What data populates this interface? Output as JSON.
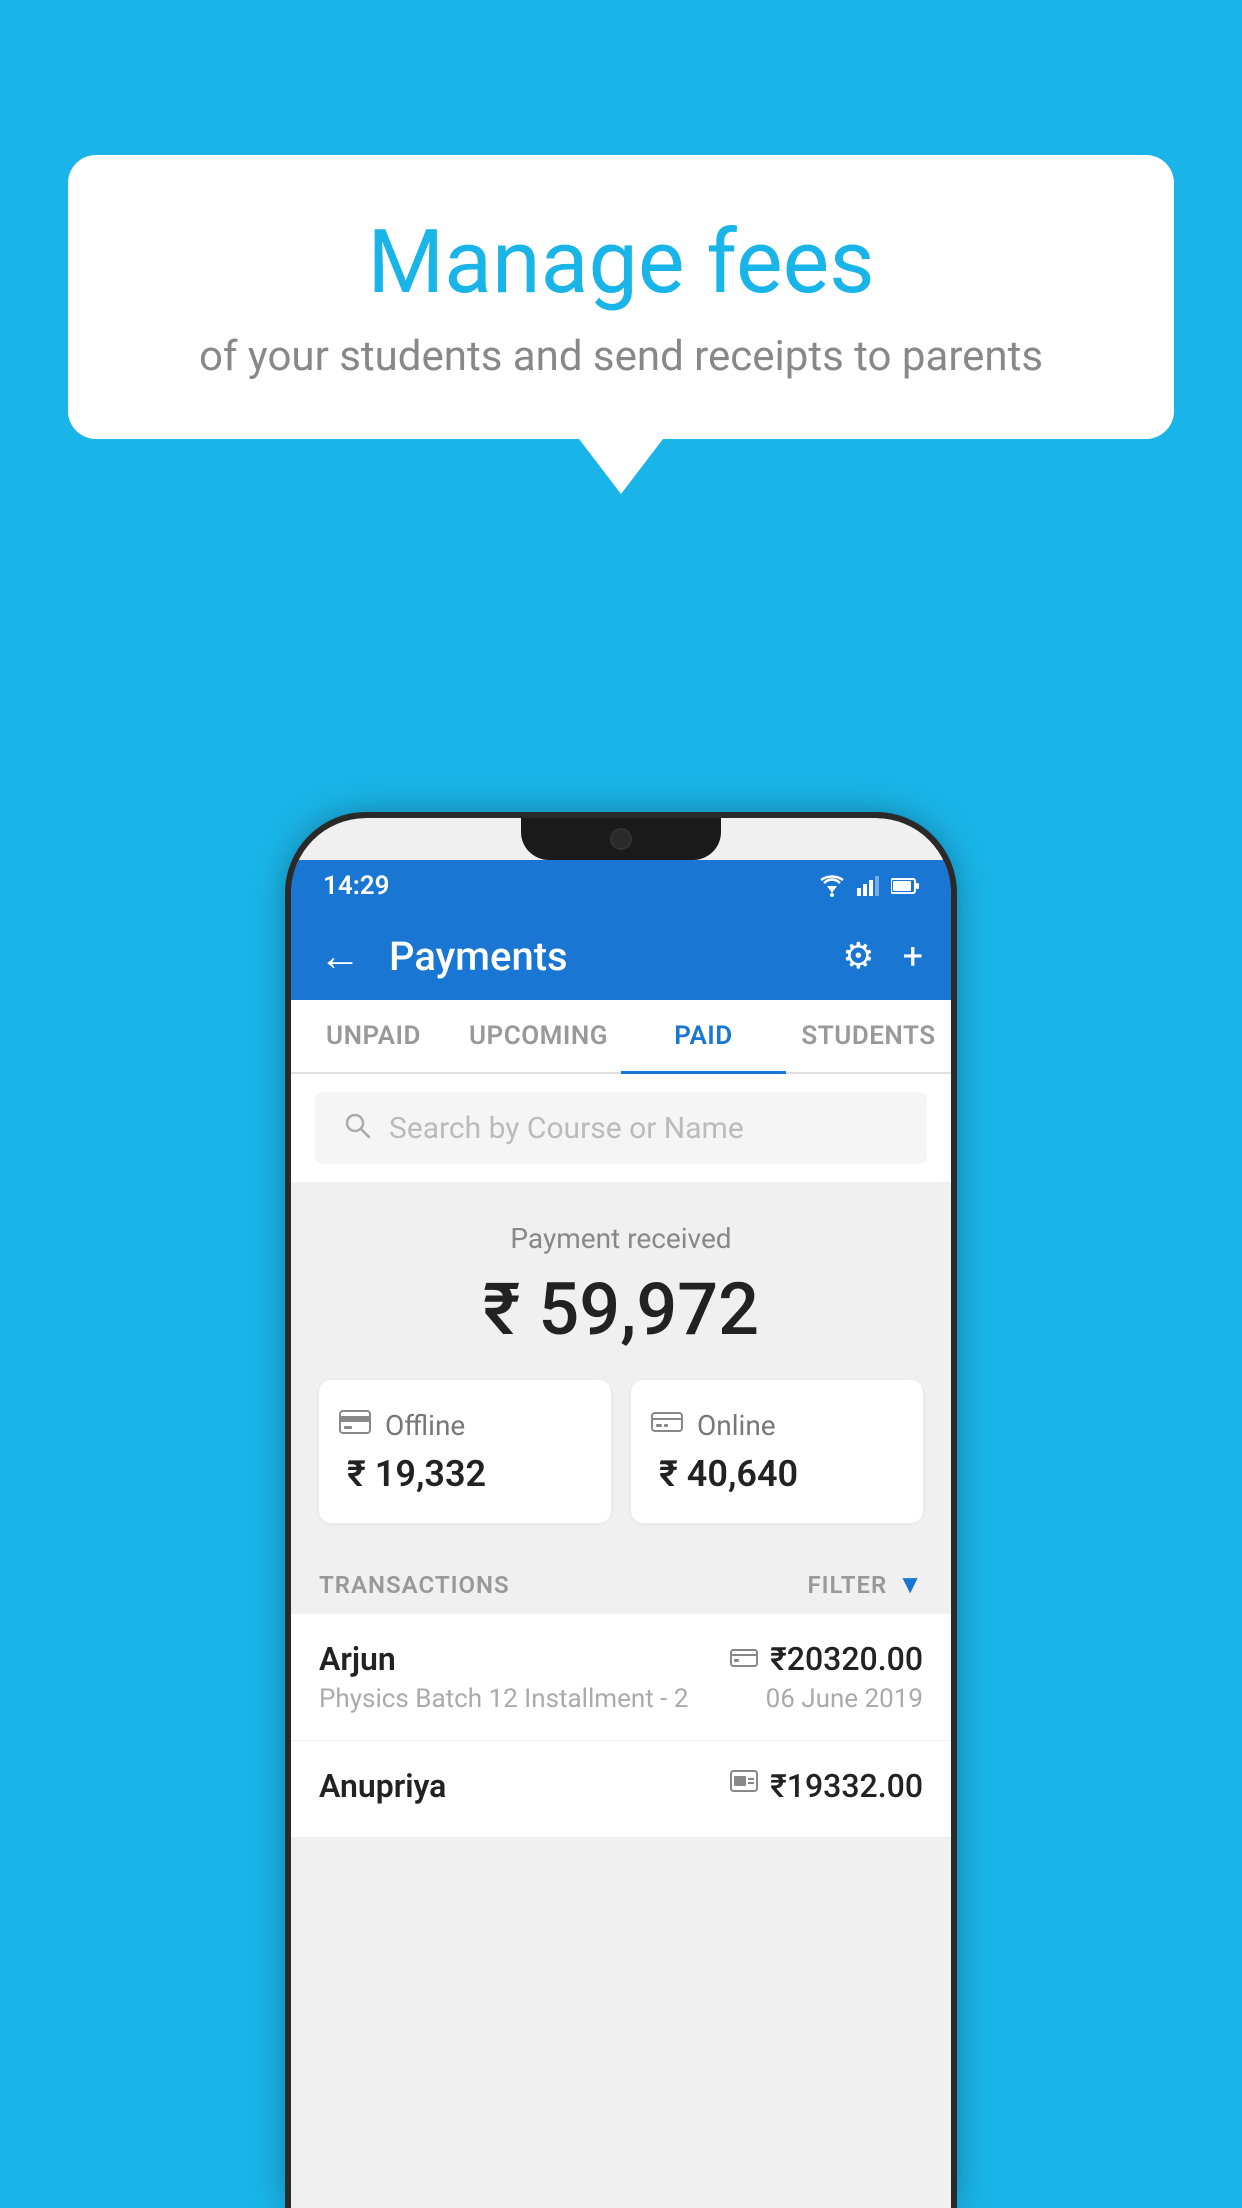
{
  "background_color": "#1ab5e8",
  "speech_bubble": {
    "title": "Manage fees",
    "subtitle": "of your students and send receipts to parents"
  },
  "status_bar": {
    "time": "14:29",
    "wifi_icon": "▲",
    "signal_icon": "▲",
    "battery_icon": "▮"
  },
  "header": {
    "title": "Payments",
    "back_icon": "←",
    "settings_icon": "⚙",
    "add_icon": "+"
  },
  "tabs": [
    {
      "label": "UNPAID",
      "active": false
    },
    {
      "label": "UPCOMING",
      "active": false
    },
    {
      "label": "PAID",
      "active": true
    },
    {
      "label": "STUDENTS",
      "active": false
    }
  ],
  "search": {
    "placeholder": "Search by Course or Name"
  },
  "summary": {
    "received_label": "Payment received",
    "total_amount": "₹ 59,972",
    "offline_label": "Offline",
    "offline_amount": "₹ 19,332",
    "online_label": "Online",
    "online_amount": "₹ 40,640"
  },
  "transactions_section": {
    "label": "TRANSACTIONS",
    "filter_label": "FILTER"
  },
  "transactions": [
    {
      "name": "Arjun",
      "detail": "Physics Batch 12 Installment - 2",
      "amount": "₹20320.00",
      "date": "06 June 2019",
      "payment_type": "online"
    },
    {
      "name": "Anupriya",
      "detail": "",
      "amount": "₹19332.00",
      "date": "",
      "payment_type": "offline"
    }
  ]
}
